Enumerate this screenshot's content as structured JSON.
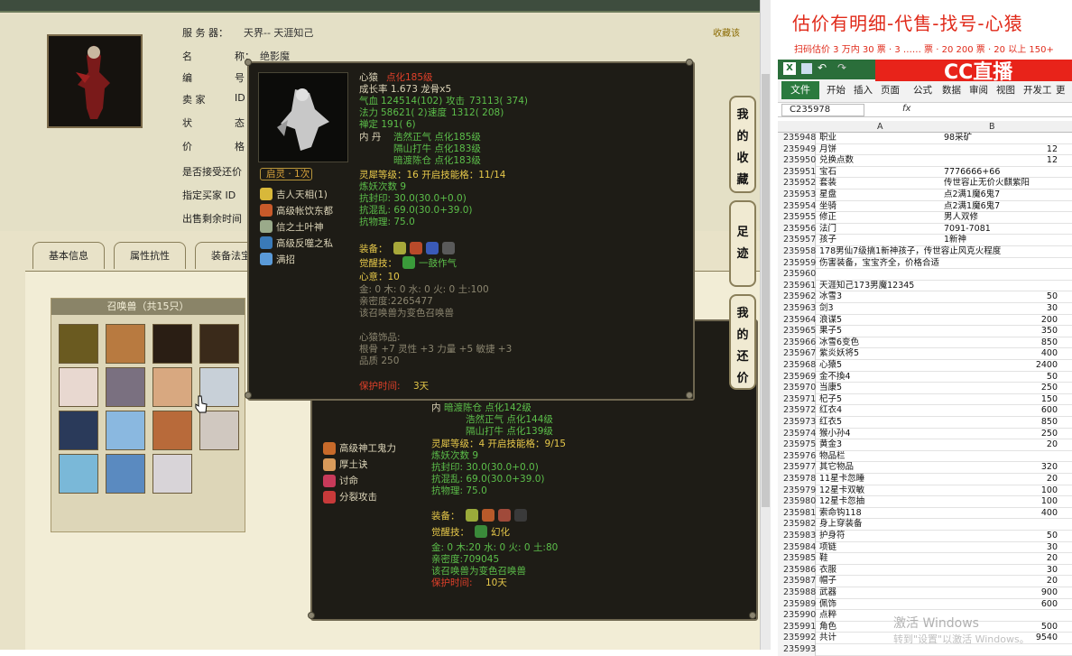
{
  "left": {
    "fav_label": "收藏该",
    "server_label": "服 务 器：",
    "server_value": "天界-- 天涯知己",
    "name_label": "名",
    "name_label2": "称：",
    "name_value": "绝影魔",
    "num_label": "编",
    "num_label2": "号",
    "seller_label": "卖   家",
    "seller_label2": "ID",
    "status_label": "状",
    "status_label2": "态",
    "price_label": "价",
    "price_label2": "格",
    "counter_offer_label": "是否接受还价",
    "buyer_id_label": "指定买家 ID",
    "remaining_label": "出售剩余时间",
    "tabs": [
      "基本信息",
      "属性抗性",
      "装备法宝"
    ],
    "summon_header": "召唤兽（共15只）"
  },
  "popup1": {
    "title_name": "心猿",
    "title_level": "点化185级",
    "growth": "成长率 1.673 龙骨x5",
    "hp_label": "气血",
    "hp_value": "124514(102)",
    "atk_label": "攻击",
    "atk_value": "73113( 374)",
    "mp_label": "法力",
    "mp_value": "58621( 2)",
    "spd_label": "速度",
    "spd_value": "1312( 208)",
    "zen": "禅定 191( 6)",
    "neidan_label": "内  丹",
    "neidan": [
      "浩然正气 点化185级",
      "隔山打牛 点化183级",
      "暗渡陈仓 点化183级"
    ],
    "badge": "启灵 · 1次",
    "skills": [
      "吉人天相(1)",
      "高级帐饮东都",
      "信之土叶神",
      "高级反噬之私",
      "满招"
    ],
    "spirit_level": "灵犀等级：16 开启技能格：11/14",
    "refine": "炼妖次数 9",
    "resist_seal": "抗封印: 30.0(30.0+0.0)",
    "resist_confuse": "抗混乱: 69.0(30.0+39.0)",
    "resist_phys": "抗物理: 75.0",
    "equip_label": "装备：",
    "awaken_label": "觉醒技：",
    "awaken_value": "一鼓作气",
    "heart": "心意：10",
    "elements": "金: 0 木: 0 水: 0 火: 0 土:100",
    "intimacy": "亲密度:2265477",
    "variant": "该召唤兽为变色召唤兽",
    "ornament_title": "心猿饰品:",
    "ornament_stats": "根骨 +7 灵性 +3 力量 +5 敏捷 +3",
    "ornament_quality": "品质   250",
    "protect_label": "保护时间:",
    "protect_value": "3天"
  },
  "popup2": {
    "neidan": [
      "暗渡陈仓 点化142级",
      "浩然正气 点化144级",
      "隔山打牛 点化139级"
    ],
    "skills": [
      "高级神工鬼力",
      "厚土诀",
      "讨命",
      "分裂攻击"
    ],
    "spirit_level": "灵犀等级：4 开启技能格：9/15",
    "refine": "炼妖次数 9",
    "resist_seal": "抗封印: 30.0(30.0+0.0)",
    "resist_confuse": "抗混乱: 69.0(30.0+39.0)",
    "resist_phys": "抗物理: 75.0",
    "equip_label": "装备：",
    "awaken_label": "觉醒技：",
    "awaken_value": "幻化",
    "elements": "金: 0 木:20 水: 0 火: 0 土:80",
    "intimacy": "亲密度:709045",
    "variant": "该召唤兽为变色召唤兽",
    "protect_label": "保护时间:",
    "protect_value": "10天"
  },
  "sidetabs": [
    [
      "我",
      "的",
      "收",
      "藏"
    ],
    [
      "足",
      "迹"
    ],
    [
      "我",
      "的",
      "还",
      "价"
    ]
  ],
  "right": {
    "banner_title": "估价有明细-代售-找号-心猿",
    "banner_sub": "扫码估价 3 万内 30 票 · 3 …… 票 · 20 200 票 · 20 以上 150+",
    "cc_logo": "CC直播",
    "ribbon_tabs": [
      "文件",
      "开始",
      "插入",
      "页面",
      "公式",
      "数据",
      "审阅",
      "视图",
      "开发工",
      "更多"
    ],
    "name_box": "C235978",
    "fx": "fx",
    "col_a": "A",
    "col_b": "B",
    "rows": [
      {
        "n": "235948",
        "a": "职业",
        "b": "98采矿",
        "r": ""
      },
      {
        "n": "235949",
        "a": "月饼",
        "b": "",
        "r": "12"
      },
      {
        "n": "235950",
        "a": "兑换点数",
        "b": "",
        "r": "12"
      },
      {
        "n": "235951",
        "a": "宝石",
        "b": "7776666+66",
        "r": ""
      },
      {
        "n": "235952",
        "a": "套装",
        "b": "传世容止无价火麒紫阳",
        "r": ""
      },
      {
        "n": "235953",
        "a": "星盘",
        "b": "点2满1魔6鬼7",
        "r": ""
      },
      {
        "n": "235954",
        "a": "坐骑",
        "b": "点2满1魔6鬼7",
        "r": ""
      },
      {
        "n": "235955",
        "a": "修正",
        "b": "男人双修",
        "r": ""
      },
      {
        "n": "235956",
        "a": "法门",
        "b": "7091-7081",
        "r": ""
      },
      {
        "n": "235957",
        "a": "孩子",
        "b": "1新神",
        "r": ""
      },
      {
        "n": "235958",
        "a": "178男仙7级搞1新神孩子，传世容止风克火程度",
        "b": "",
        "r": ""
      },
      {
        "n": "235959",
        "a": "伤害装备，宝宝齐全，价格合适",
        "b": "",
        "r": ""
      },
      {
        "n": "235960",
        "a": "",
        "b": "",
        "r": ""
      },
      {
        "n": "235961",
        "a": "天涯知己173男魔12345",
        "b": "",
        "r": ""
      },
      {
        "n": "235962",
        "a": "冰雪3",
        "b": "",
        "r": "50"
      },
      {
        "n": "235963",
        "a": "剑3",
        "b": "",
        "r": "30"
      },
      {
        "n": "235964",
        "a": "浪谋5",
        "b": "",
        "r": "200"
      },
      {
        "n": "235965",
        "a": "果子5",
        "b": "",
        "r": "350"
      },
      {
        "n": "235966",
        "a": "冰雪6变色",
        "b": "",
        "r": "850"
      },
      {
        "n": "235967",
        "a": "紫炎妖将5",
        "b": "",
        "r": "400"
      },
      {
        "n": "235968",
        "a": "心猿5",
        "b": "",
        "r": "2400"
      },
      {
        "n": "235969",
        "a": "金不換4",
        "b": "",
        "r": "50"
      },
      {
        "n": "235970",
        "a": "当康5",
        "b": "",
        "r": "250"
      },
      {
        "n": "235971",
        "a": "杞子5",
        "b": "",
        "r": "150"
      },
      {
        "n": "235972",
        "a": "红衣4",
        "b": "",
        "r": "600"
      },
      {
        "n": "235973",
        "a": "红衣5",
        "b": "",
        "r": "850"
      },
      {
        "n": "235974",
        "a": "猴小孙4",
        "b": "",
        "r": "250"
      },
      {
        "n": "235975",
        "a": "黄金3",
        "b": "",
        "r": "20"
      },
      {
        "n": "235976",
        "a": "物品栏",
        "b": "",
        "r": ""
      },
      {
        "n": "235977",
        "a": "其它物品",
        "b": "",
        "r": "320"
      },
      {
        "n": "235978",
        "a": "11星卡忽睡",
        "b": "",
        "r": "20"
      },
      {
        "n": "235979",
        "a": "12星卡双敏",
        "b": "",
        "r": "100"
      },
      {
        "n": "235980",
        "a": "12星卡忽抽",
        "b": "",
        "r": "100"
      },
      {
        "n": "235981",
        "a": "索命钩118",
        "b": "",
        "r": "400"
      },
      {
        "n": "235982",
        "a": "身上穿装备",
        "b": "",
        "r": ""
      },
      {
        "n": "235983",
        "a": "护身符",
        "b": "",
        "r": "50"
      },
      {
        "n": "235984",
        "a": "项链",
        "b": "",
        "r": "30"
      },
      {
        "n": "235985",
        "a": "鞋",
        "b": "",
        "r": "20"
      },
      {
        "n": "235986",
        "a": "衣服",
        "b": "",
        "r": "30"
      },
      {
        "n": "235987",
        "a": "帽子",
        "b": "",
        "r": "20"
      },
      {
        "n": "235988",
        "a": "武器",
        "b": "",
        "r": "900"
      },
      {
        "n": "235989",
        "a": "佩饰",
        "b": "",
        "r": "600"
      },
      {
        "n": "235990",
        "a": "点粹",
        "b": "",
        "r": ""
      },
      {
        "n": "235991",
        "a": "角色",
        "b": "",
        "r": "500"
      },
      {
        "n": "235992",
        "a": "共计",
        "b": "",
        "r": "9540"
      },
      {
        "n": "235993",
        "a": "",
        "b": "",
        "r": ""
      }
    ],
    "watermark": "激活 Windows",
    "watermark_sub": "转到\"设置\"以激活 Windows。"
  },
  "colors": {
    "red": "#e02a1a",
    "green": "#5cbf4a",
    "yellow": "#e6c84a",
    "popup_bg": "#1e1c16",
    "panel_bg": "#e8e2c8"
  }
}
